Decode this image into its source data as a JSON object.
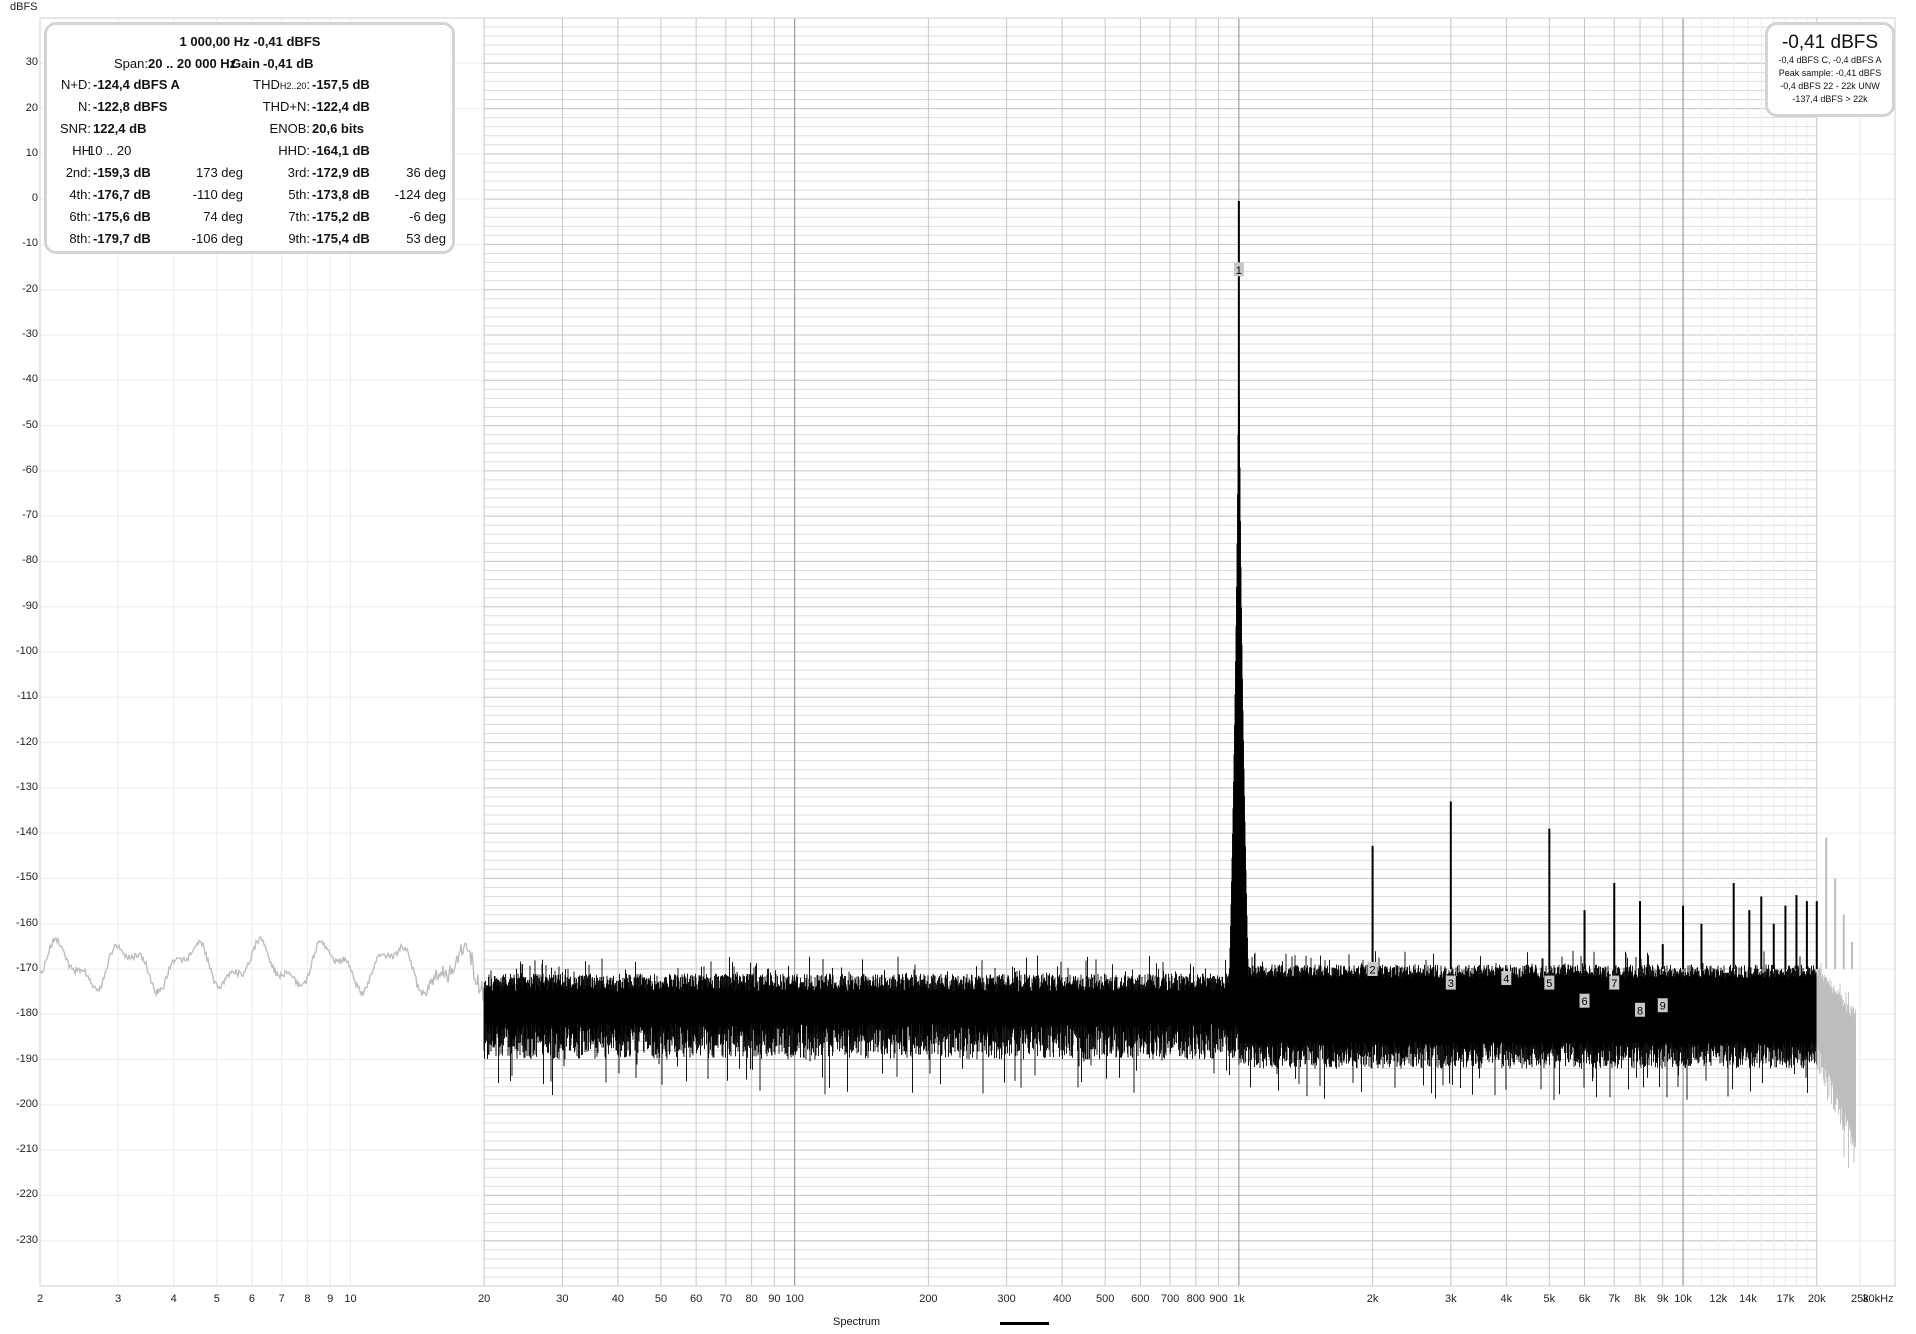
{
  "y_unit": "dBFS",
  "info_box": {
    "title": "1 000,00 Hz  -0,41 dBFS",
    "span_label": "Span:",
    "span_value": "20 .. 20 000 Hz",
    "gain_label": "Gain",
    "gain_value": "-0,41 dB",
    "rows": [
      {
        "l1": "N+D:",
        "v1": "-124,4 dBFS A",
        "d1": "",
        "l2": "THD",
        "l2sub": "H2..20",
        "l2end": ":",
        "v2": "-157,5 dB",
        "d2": ""
      },
      {
        "l1": "N:",
        "v1": "-122,8 dBFS",
        "d1": "",
        "l2": "THD+N:",
        "v2": "-122,4 dB",
        "d2": ""
      },
      {
        "l1": "SNR:",
        "v1": "122,4 dB",
        "d1": "",
        "l2": "ENOB:",
        "v2": "20,6 bits",
        "d2": ""
      },
      {
        "l1": "HH",
        "v1": "10 .. 20",
        "d1": "",
        "l2": "HHD:",
        "v2": "-164,1 dB",
        "d2": ""
      },
      {
        "l1": "2nd:",
        "v1": "-159,3 dB",
        "d1": "173 deg",
        "l2": "3rd:",
        "v2": "-172,9 dB",
        "d2": "36 deg"
      },
      {
        "l1": "4th:",
        "v1": "-176,7 dB",
        "d1": "-110 deg",
        "l2": "5th:",
        "v2": "-173,8 dB",
        "d2": "-124 deg"
      },
      {
        "l1": "6th:",
        "v1": "-175,6 dB",
        "d1": "74 deg",
        "l2": "7th:",
        "v2": "-175,2 dB",
        "d2": "-6 deg"
      },
      {
        "l1": "8th:",
        "v1": "-179,7 dB",
        "d1": "-106 deg",
        "l2": "9th:",
        "v2": "-175,4 dB",
        "d2": "53 deg"
      }
    ]
  },
  "level_box": {
    "main": "-0,41 dBFS",
    "lines": [
      "-0,4 dBFS C, -0,4 dBFS A",
      "Peak sample: -0,41 dBFS",
      "-0,4 dBFS 22 -  22k UNW",
      "-137,4 dBFS > 22k"
    ]
  },
  "legend": {
    "label": "Spectrum",
    "color": "#000000"
  },
  "chart_data": {
    "type": "line",
    "title": "",
    "xlabel": "Hz",
    "ylabel": "dBFS",
    "xscale": "log",
    "xlim": [
      2,
      30000
    ],
    "ylim": [
      -240,
      40
    ],
    "measurement_span_hz": [
      20,
      20000
    ],
    "yticks": [
      30,
      20,
      10,
      0,
      -10,
      -20,
      -30,
      -40,
      -50,
      -60,
      -70,
      -80,
      -90,
      -100,
      -110,
      -120,
      -130,
      -140,
      -150,
      -160,
      -170,
      -180,
      -190,
      -200,
      -210,
      -220,
      -230
    ],
    "xticks": [
      {
        "f": 2,
        "label": "2"
      },
      {
        "f": 3,
        "label": "3"
      },
      {
        "f": 4,
        "label": "4"
      },
      {
        "f": 5,
        "label": "5"
      },
      {
        "f": 6,
        "label": "6"
      },
      {
        "f": 7,
        "label": "7"
      },
      {
        "f": 8,
        "label": "8"
      },
      {
        "f": 9,
        "label": "9"
      },
      {
        "f": 10,
        "label": "10"
      },
      {
        "f": 20,
        "label": "20"
      },
      {
        "f": 30,
        "label": "30"
      },
      {
        "f": 40,
        "label": "40"
      },
      {
        "f": 50,
        "label": "50"
      },
      {
        "f": 60,
        "label": "60"
      },
      {
        "f": 70,
        "label": "70"
      },
      {
        "f": 80,
        "label": "80"
      },
      {
        "f": 90,
        "label": "90"
      },
      {
        "f": 100,
        "label": "100"
      },
      {
        "f": 200,
        "label": "200"
      },
      {
        "f": 300,
        "label": "300"
      },
      {
        "f": 400,
        "label": "400"
      },
      {
        "f": 500,
        "label": "500"
      },
      {
        "f": 600,
        "label": "600"
      },
      {
        "f": 700,
        "label": "700"
      },
      {
        "f": 800,
        "label": "800"
      },
      {
        "f": 900,
        "label": "900"
      },
      {
        "f": 1000,
        "label": "1k"
      },
      {
        "f": 2000,
        "label": "2k"
      },
      {
        "f": 3000,
        "label": "3k"
      },
      {
        "f": 4000,
        "label": "4k"
      },
      {
        "f": 5000,
        "label": "5k"
      },
      {
        "f": 6000,
        "label": "6k"
      },
      {
        "f": 7000,
        "label": "7k"
      },
      {
        "f": 8000,
        "label": "8k"
      },
      {
        "f": 9000,
        "label": "9k"
      },
      {
        "f": 10000,
        "label": "10k"
      },
      {
        "f": 12000,
        "label": "12k"
      },
      {
        "f": 14000,
        "label": "14k"
      },
      {
        "f": 17000,
        "label": "17k"
      },
      {
        "f": 20000,
        "label": "20k"
      },
      {
        "f": 25000,
        "label": "25k"
      },
      {
        "f": 29000,
        "label": "30kHz"
      }
    ],
    "fundamental": {
      "f": 1000,
      "peak_db": -0.41,
      "marker": "1",
      "marker_db": -15.5
    },
    "noise_floor_db": {
      "below_1k": [
        -186,
        -171
      ],
      "above_1k": [
        -192,
        -169
      ]
    },
    "spurs": [
      [
        2000,
        -142.8
      ],
      [
        3000,
        -133
      ],
      [
        5000,
        -139
      ],
      [
        6000,
        -157
      ],
      [
        7000,
        -151
      ],
      [
        8000,
        -155
      ],
      [
        9000,
        -164.5
      ],
      [
        10000,
        -156
      ],
      [
        11000,
        -160
      ],
      [
        13000,
        -151
      ],
      [
        14100,
        -157
      ],
      [
        15000,
        -154
      ],
      [
        16000,
        -160
      ],
      [
        17000,
        -156
      ],
      [
        18000,
        -153.7
      ],
      [
        19000,
        -155
      ],
      [
        20000,
        -155
      ],
      [
        21000,
        -141
      ],
      [
        22000,
        -150
      ],
      [
        23000,
        -158
      ],
      [
        24000,
        -164
      ]
    ],
    "harmonic_markers": [
      {
        "label": "2",
        "f": 2000,
        "db": -170
      },
      {
        "label": "3",
        "f": 3000,
        "db": -173
      },
      {
        "label": "4",
        "f": 4000,
        "db": -172
      },
      {
        "label": "5",
        "f": 5000,
        "db": -173
      },
      {
        "label": "6",
        "f": 6000,
        "db": -177
      },
      {
        "label": "7",
        "f": 7000,
        "db": -173
      },
      {
        "label": "8",
        "f": 8000,
        "db": -179
      },
      {
        "label": "9",
        "f": 9000,
        "db": -178
      }
    ]
  }
}
